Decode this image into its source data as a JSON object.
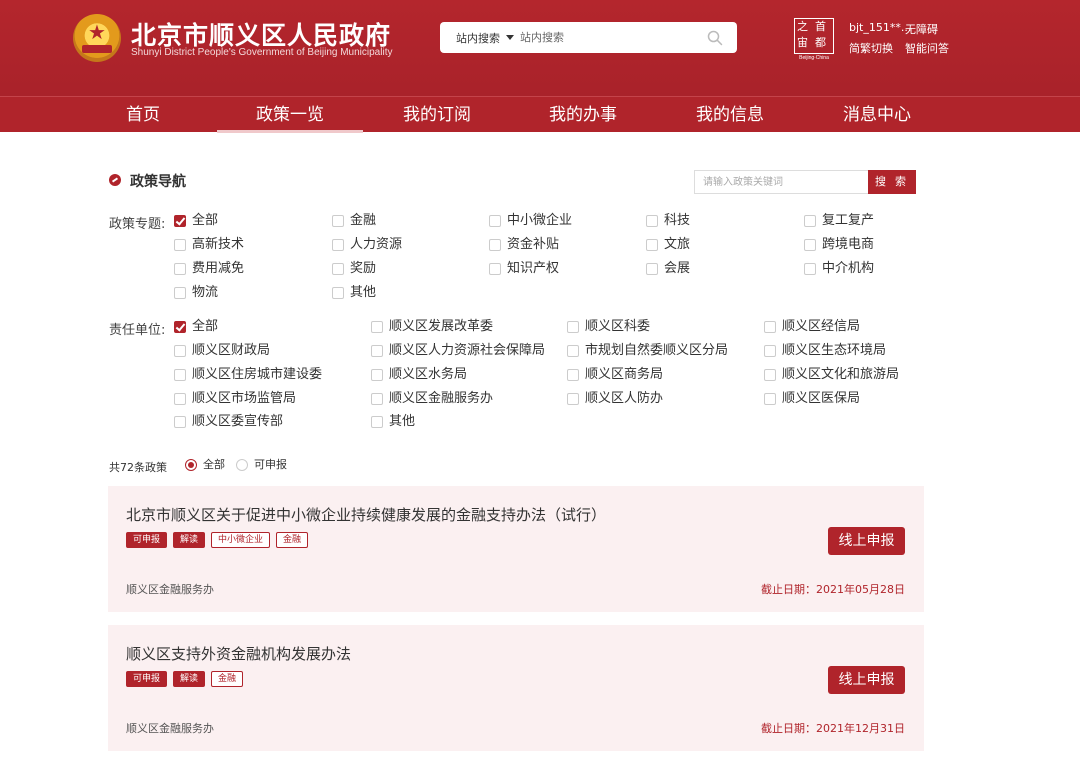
{
  "header": {
    "title": "北京市顺义区人民政府",
    "subtitle": "Shunyi District People's Government of Beijing Municipality",
    "search_scope": "站内搜索",
    "search_placeholder": "站内搜索",
    "logo_glyphs": [
      "之",
      "首",
      "宙",
      "都"
    ],
    "logo_caption": "Beijing·China",
    "user": "bjt_151**...",
    "accessibility": "无障碍",
    "lang_switch": "简繁切换",
    "smart_qa": "智能问答"
  },
  "nav": {
    "items": [
      "首页",
      "政策一览",
      "我的订阅",
      "我的办事",
      "我的信息",
      "消息中心"
    ],
    "active_index": 1
  },
  "policy_nav": {
    "title": "政策导航",
    "keyword_placeholder": "请输入政策关键词",
    "search_button": "搜 索",
    "topic_label": "政策专题:",
    "topics": [
      {
        "label": "全部",
        "checked": true
      },
      {
        "label": "金融",
        "checked": false
      },
      {
        "label": "中小微企业",
        "checked": false
      },
      {
        "label": "科技",
        "checked": false
      },
      {
        "label": "复工复产",
        "checked": false
      },
      {
        "label": "高新技术",
        "checked": false
      },
      {
        "label": "人力资源",
        "checked": false
      },
      {
        "label": "资金补贴",
        "checked": false
      },
      {
        "label": "文旅",
        "checked": false
      },
      {
        "label": "跨境电商",
        "checked": false
      },
      {
        "label": "费用减免",
        "checked": false
      },
      {
        "label": "奖励",
        "checked": false
      },
      {
        "label": "知识产权",
        "checked": false
      },
      {
        "label": "会展",
        "checked": false
      },
      {
        "label": "中介机构",
        "checked": false
      },
      {
        "label": "物流",
        "checked": false
      },
      {
        "label": "其他",
        "checked": false
      }
    ],
    "dept_label": "责任单位:",
    "depts": [
      {
        "label": "全部",
        "checked": true
      },
      {
        "label": "顺义区发展改革委",
        "checked": false
      },
      {
        "label": "顺义区科委",
        "checked": false
      },
      {
        "label": "顺义区经信局",
        "checked": false
      },
      {
        "label": "顺义区财政局",
        "checked": false
      },
      {
        "label": "顺义区人力资源社会保障局",
        "checked": false
      },
      {
        "label": "市规划自然委顺义区分局",
        "checked": false
      },
      {
        "label": "顺义区生态环境局",
        "checked": false
      },
      {
        "label": "顺义区住房城市建设委",
        "checked": false
      },
      {
        "label": "顺义区水务局",
        "checked": false
      },
      {
        "label": "顺义区商务局",
        "checked": false
      },
      {
        "label": "顺义区文化和旅游局",
        "checked": false
      },
      {
        "label": "顺义区市场监管局",
        "checked": false
      },
      {
        "label": "顺义区金融服务办",
        "checked": false
      },
      {
        "label": "顺义区人防办",
        "checked": false
      },
      {
        "label": "顺义区医保局",
        "checked": false
      },
      {
        "label": "顺义区委宣传部",
        "checked": false
      },
      {
        "label": "其他",
        "checked": false
      }
    ]
  },
  "results": {
    "count_text": "共72条政策",
    "filter_all": "全部",
    "filter_applicable": "可申报",
    "selected_filter": "全部",
    "items": [
      {
        "title": "北京市顺义区关于促进中小微企业持续健康发展的金融支持办法（试行）",
        "tags": [
          {
            "text": "可申报",
            "style": "solid"
          },
          {
            "text": "解读",
            "style": "solid"
          },
          {
            "text": "中小微企业",
            "style": "outline"
          },
          {
            "text": "金融",
            "style": "outline"
          }
        ],
        "apply_label": "线上申报",
        "dept": "顺义区金融服务办",
        "deadline": "截止日期：2021年05月28日"
      },
      {
        "title": "顺义区支持外资金融机构发展办法",
        "tags": [
          {
            "text": "可申报",
            "style": "solid"
          },
          {
            "text": "解读",
            "style": "solid"
          },
          {
            "text": "金融",
            "style": "outline"
          }
        ],
        "apply_label": "线上申报",
        "dept": "顺义区金融服务办",
        "deadline": "截止日期：2021年12月31日"
      }
    ]
  },
  "colors": {
    "brand_red": "#b0242b",
    "card_bg": "#fbf0f1"
  }
}
